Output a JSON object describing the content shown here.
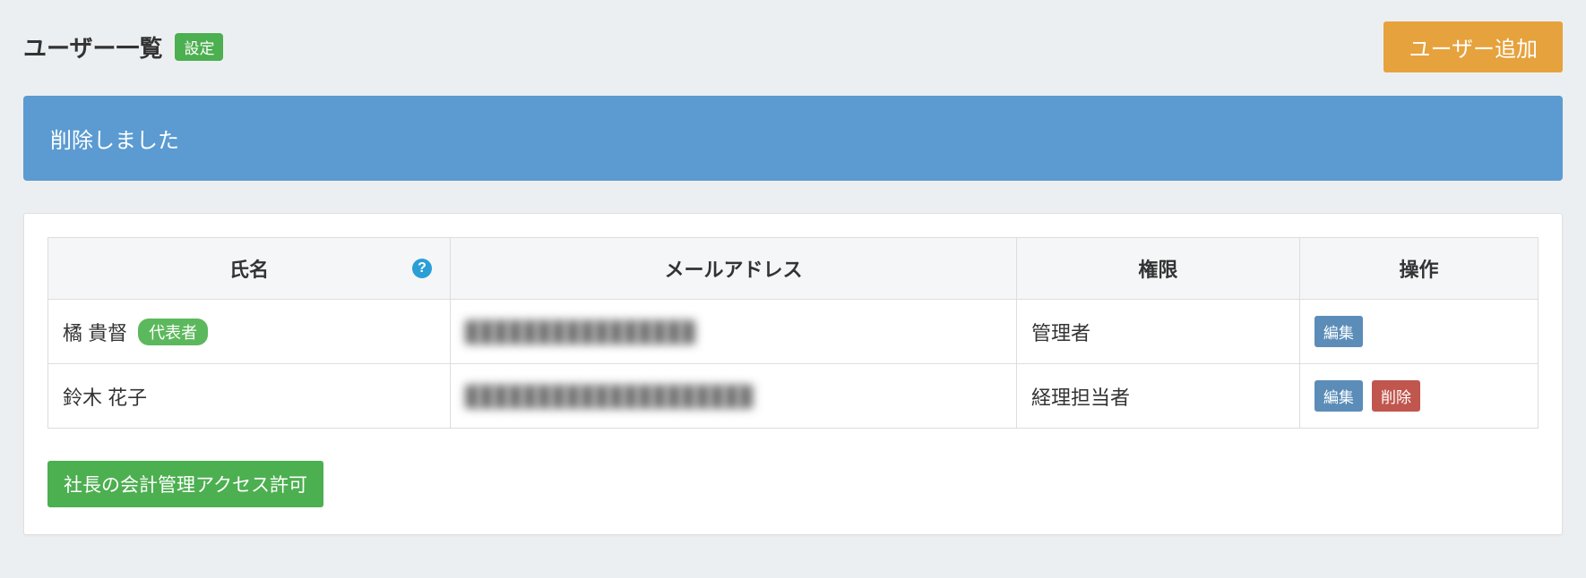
{
  "header": {
    "title": "ユーザー一覧",
    "settings_badge": "設定",
    "add_user_label": "ユーザー追加"
  },
  "alert": {
    "message": "削除しました"
  },
  "table": {
    "columns": {
      "name": "氏名",
      "email": "メールアドレス",
      "role": "権限",
      "action": "操作"
    },
    "rows": [
      {
        "name": "橘 貴督",
        "rep_badge": "代表者",
        "email": "████████████████",
        "role": "管理者",
        "edit_label": "編集",
        "delete_label": null
      },
      {
        "name": "鈴木 花子",
        "rep_badge": null,
        "email": "████████████████████",
        "role": "経理担当者",
        "edit_label": "編集",
        "delete_label": "削除"
      }
    ]
  },
  "footer": {
    "access_button": "社長の会計管理アクセス許可"
  }
}
